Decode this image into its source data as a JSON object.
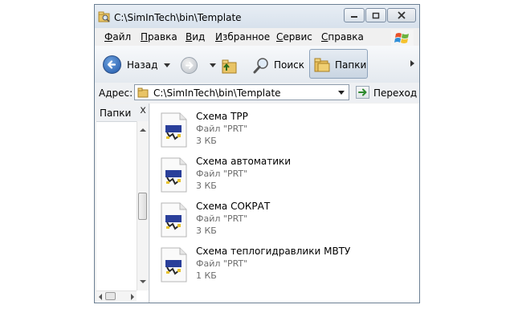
{
  "window": {
    "title": "C:\\SimInTech\\bin\\Template"
  },
  "menu": [
    "Файл",
    "Правка",
    "Вид",
    "Избранное",
    "Сервис",
    "Справка"
  ],
  "toolbar": {
    "back_label": "Назад",
    "search_label": "Поиск",
    "folders_label": "Папки"
  },
  "address": {
    "label": "Адрес:",
    "value": "C:\\SimInTech\\bin\\Template",
    "go_label": "Переход"
  },
  "folders_pane": {
    "title": "Папки",
    "close_glyph": "x"
  },
  "files": [
    {
      "name": "Схема TPP",
      "type": "Файл \"PRT\"",
      "size": "3 КБ"
    },
    {
      "name": "Схема автоматики",
      "type": "Файл \"PRT\"",
      "size": "3 КБ"
    },
    {
      "name": "Схема СОКРАТ",
      "type": "Файл \"PRT\"",
      "size": "3 КБ"
    },
    {
      "name": "Схема теплогидравлики МВТУ",
      "type": "Файл \"PRT\"",
      "size": "1 КБ"
    }
  ]
}
